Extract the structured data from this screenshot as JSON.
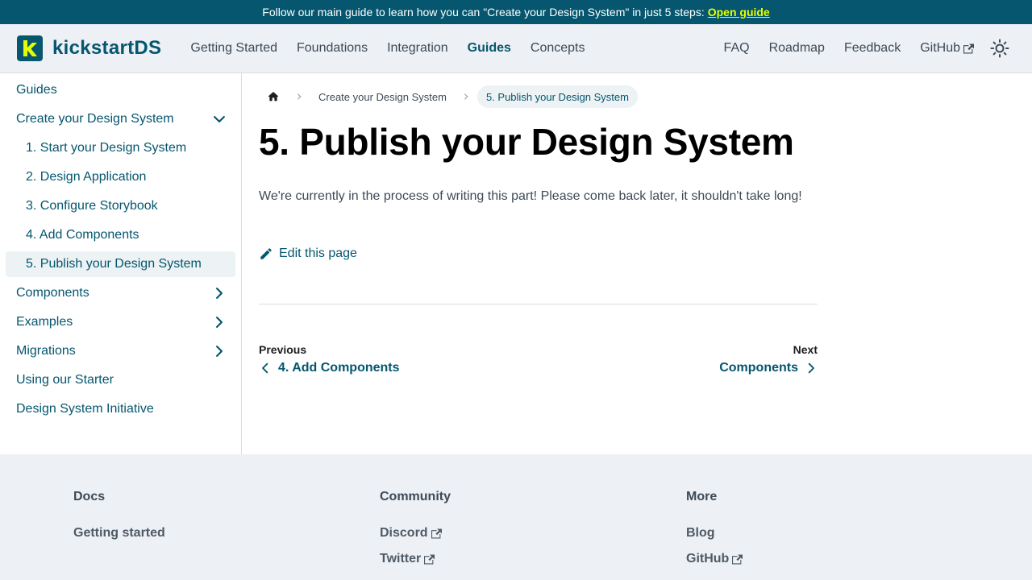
{
  "banner": {
    "text": "Follow our main guide to learn how you can \"Create your Design System\" in just 5 steps:",
    "link": "Open guide"
  },
  "brand": {
    "name": "kickstartDS",
    "logo_letter": "k"
  },
  "nav": {
    "left": [
      "Getting Started",
      "Foundations",
      "Integration",
      "Guides",
      "Concepts"
    ],
    "active": "Guides",
    "right": [
      "FAQ",
      "Roadmap",
      "Feedback",
      "GitHub"
    ]
  },
  "sidebar": {
    "items": [
      {
        "label": "Guides"
      },
      {
        "label": "Create your Design System",
        "chevron": "chevron-down-icon"
      },
      {
        "label": "1. Start your Design System"
      },
      {
        "label": "2. Design Application"
      },
      {
        "label": "3. Configure Storybook"
      },
      {
        "label": "4. Add Components"
      },
      {
        "label": "5. Publish your Design System",
        "active": true
      },
      {
        "label": "Components",
        "chevron": "chevron-right-icon"
      },
      {
        "label": "Examples",
        "chevron": "chevron-right-icon"
      },
      {
        "label": "Migrations",
        "chevron": "chevron-right-icon"
      },
      {
        "label": "Using our Starter"
      },
      {
        "label": "Design System Initiative"
      }
    ]
  },
  "breadcrumbs": [
    "Create your Design System",
    "5. Publish your Design System"
  ],
  "page": {
    "title": "5. Publish your Design System",
    "text": "We're currently in the process of writing this part! Please come back later, it shouldn't take long!",
    "edit_label": "Edit this page"
  },
  "pager": {
    "prev": {
      "sub": "Previous",
      "label": "4. Add Components"
    },
    "next": {
      "sub": "Next",
      "label": "Components"
    }
  },
  "footer": {
    "cols": [
      {
        "title": "Docs",
        "links": [
          "Getting started"
        ]
      },
      {
        "title": "Community",
        "links": [
          "Discord",
          "Twitter"
        ]
      },
      {
        "title": "More",
        "links": [
          "Blog",
          "GitHub"
        ]
      }
    ]
  },
  "colors": {
    "brand": "#05566e",
    "accent": "#e6ff00",
    "text": "#3d4a57"
  }
}
